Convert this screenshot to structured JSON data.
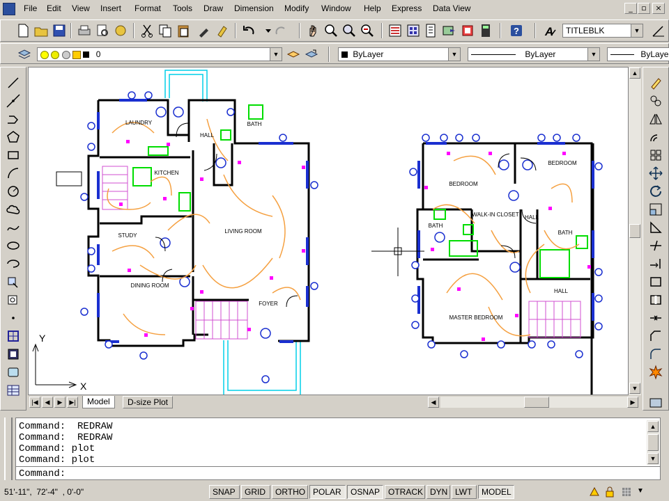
{
  "menu": {
    "items": [
      "File",
      "Edit",
      "View",
      "Insert",
      "Format",
      "Tools",
      "Draw",
      "Dimension",
      "Modify",
      "Window",
      "Help",
      "Express",
      "Data View"
    ]
  },
  "window_controls": {
    "minimize": "_",
    "restore": "▫",
    "close": "×"
  },
  "toolbar_standard": {
    "text_style_value": "TITLEBLK"
  },
  "toolbar_layers": {
    "layer_value": "0",
    "color_value": "ByLayer",
    "linetype_value": "ByLayer",
    "lineweight_value": "ByLayer"
  },
  "drawing": {
    "ground_floor_rooms": [
      "LAUNDRY",
      "KITCHEN",
      "STUDY",
      "DINING ROOM",
      "LIVING ROOM",
      "FOYER",
      "HALL",
      "BATH"
    ],
    "upper_floor_rooms": [
      "BEDROOM",
      "BEDROOM",
      "WALK-IN CLOSET",
      "BATH",
      "HALL",
      "BATH",
      "MASTER BEDROOM",
      "HALL"
    ],
    "ucs_x_label": "X",
    "ucs_y_label": "Y"
  },
  "layout_tabs": {
    "tabs": [
      "Model",
      "D-size Plot"
    ],
    "active_tab": "Model"
  },
  "command_history": {
    "lines": [
      "Command:  REDRAW",
      "Command:  REDRAW",
      "Command: plot",
      "Command: plot"
    ],
    "prompt": "Command:"
  },
  "status_bar": {
    "coordinates": "51'-11\",  72'-4\"  , 0'-0\"",
    "toggles": [
      {
        "label": "SNAP",
        "on": false
      },
      {
        "label": "GRID",
        "on": false
      },
      {
        "label": "ORTHO",
        "on": false
      },
      {
        "label": "POLAR",
        "on": true
      },
      {
        "label": "OSNAP",
        "on": true
      },
      {
        "label": "OTRACK",
        "on": false
      },
      {
        "label": "DYN",
        "on": false
      },
      {
        "label": "LWT",
        "on": false
      },
      {
        "label": "MODEL",
        "on": true
      }
    ]
  },
  "colors": {
    "wall": "#000000",
    "window": "#1a2fd0",
    "outlet": "#ff00ff",
    "wiring": "#f5a040",
    "fixture": "#00dd00",
    "porch": "#00cfe8"
  }
}
